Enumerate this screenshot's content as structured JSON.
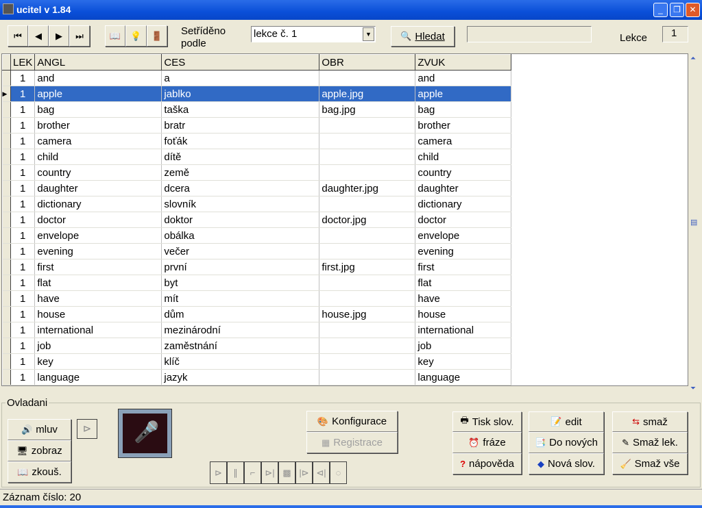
{
  "window": {
    "title": "ucitel v 1.84"
  },
  "toolbar": {
    "sorted_label": "Setříděno podle",
    "sort_value": "lekce č. 1",
    "search_label": "Hledat",
    "search_value": "",
    "lesson_label": "Lekce",
    "lesson_value": "1"
  },
  "grid": {
    "columns": [
      "LEK",
      "ANGL",
      "CES",
      "OBR",
      "ZVUK"
    ],
    "rows": [
      [
        "1",
        "and",
        "a",
        "",
        "and"
      ],
      [
        "1",
        "apple",
        "jablko",
        "apple.jpg",
        "apple"
      ],
      [
        "1",
        "bag",
        "taška",
        "bag.jpg",
        "bag"
      ],
      [
        "1",
        "brother",
        "bratr",
        "",
        "brother"
      ],
      [
        "1",
        "camera",
        "foťák",
        "",
        "camera"
      ],
      [
        "1",
        "child",
        "dítě",
        "",
        "child"
      ],
      [
        "1",
        "country",
        "země",
        "",
        "country"
      ],
      [
        "1",
        "daughter",
        "dcera",
        "daughter.jpg",
        "daughter"
      ],
      [
        "1",
        "dictionary",
        "slovník",
        "",
        "dictionary"
      ],
      [
        "1",
        "doctor",
        "doktor",
        "doctor.jpg",
        "doctor"
      ],
      [
        "1",
        "envelope",
        "obálka",
        "",
        "envelope"
      ],
      [
        "1",
        "evening",
        "večer",
        "",
        "evening"
      ],
      [
        "1",
        "first",
        "první",
        "first.jpg",
        "first"
      ],
      [
        "1",
        "flat",
        "byt",
        "",
        "flat"
      ],
      [
        "1",
        "have",
        "mít",
        "",
        "have"
      ],
      [
        "1",
        "house",
        "dům",
        "house.jpg",
        "house"
      ],
      [
        "1",
        "international",
        "mezinárodní",
        "",
        "international"
      ],
      [
        "1",
        "job",
        "zaměstnání",
        "",
        "job"
      ],
      [
        "1",
        "key",
        "klíč",
        "",
        "key"
      ],
      [
        "1",
        "language",
        "jazyk",
        "",
        "language"
      ]
    ],
    "selected_index": 1
  },
  "panel": {
    "title": "Ovladani",
    "mluv": "mluv",
    "zobraz": "zobraz",
    "zkous": "zkouš.",
    "konfigurace": "Konfigurace",
    "registrace": "Registrace",
    "tisk": "Tisk slov.",
    "fraze": "fráze",
    "napoveda": "nápověda",
    "edit": "edit",
    "do_novych": "Do nových",
    "nova_slov": "Nová slov.",
    "smaz": "smaž",
    "smaz_lek": "Smaž lek.",
    "smaz_vse": "Smaž vše"
  },
  "status": {
    "text": "Záznam číslo: 20"
  },
  "colors": {
    "selection": "#316ac5",
    "titlebar": "#0a4fd8",
    "face": "#ece9d8"
  }
}
